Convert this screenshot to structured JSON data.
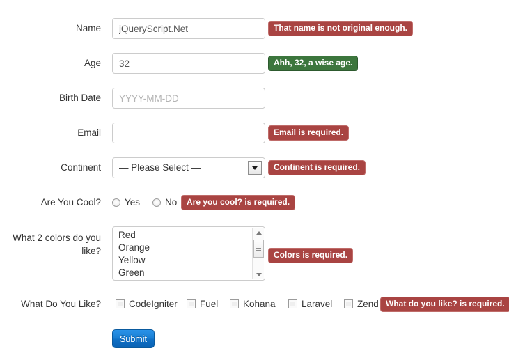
{
  "form": {
    "fields": [
      {
        "id": "name",
        "label": "Name",
        "type": "text",
        "value": "jQueryScript.Net",
        "placeholder": "",
        "message": "That name is not original enough.",
        "message_state": "error"
      },
      {
        "id": "age",
        "label": "Age",
        "type": "text",
        "value": "32",
        "placeholder": "",
        "message": "Ahh, 32, a wise age.",
        "message_state": "success"
      },
      {
        "id": "birth_date",
        "label": "Birth Date",
        "type": "text",
        "value": "",
        "placeholder": "YYYY-MM-DD",
        "message": "",
        "message_state": "none"
      },
      {
        "id": "email",
        "label": "Email",
        "type": "text",
        "value": "",
        "placeholder": "",
        "message": "Email is required.",
        "message_state": "error"
      },
      {
        "id": "continent",
        "label": "Continent",
        "type": "select",
        "value": "— Please Select —",
        "message": "Continent is required.",
        "message_state": "error"
      },
      {
        "id": "are_you_cool",
        "label": "Are You Cool?",
        "type": "radio",
        "options": [
          "Yes",
          "No"
        ],
        "message": "Are you cool? is required.",
        "message_state": "error"
      },
      {
        "id": "colors",
        "label": "What 2 colors do you like?",
        "type": "multiselect",
        "options": [
          "Red",
          "Orange",
          "Yellow",
          "Green"
        ],
        "message": "Colors is required.",
        "message_state": "error"
      },
      {
        "id": "what_do_you_like",
        "label": "What Do You Like?",
        "type": "checkbox",
        "options": [
          "CodeIgniter",
          "Fuel",
          "Kohana",
          "Laravel",
          "Zend"
        ],
        "message": "What do you like? is required.",
        "message_state": "error"
      }
    ],
    "submit_label": "Submit"
  },
  "colors": {
    "error_bg": "#a94442",
    "error_border": "#bf6b69",
    "success_bg": "#3c763d",
    "success_border": "#2d5a2e",
    "submit_bg": "#1a7fd4",
    "input_border": "#cccccc",
    "text": "#333333",
    "placeholder": "#b4b4b4",
    "page_bg": "#ffffff"
  },
  "icons": {
    "select_arrow": "chevron-down-icon",
    "scroll_up": "scroll-up-arrow-icon",
    "scroll_down": "scroll-down-arrow-icon",
    "scroll_thumb": "scrollbar-thumb"
  }
}
